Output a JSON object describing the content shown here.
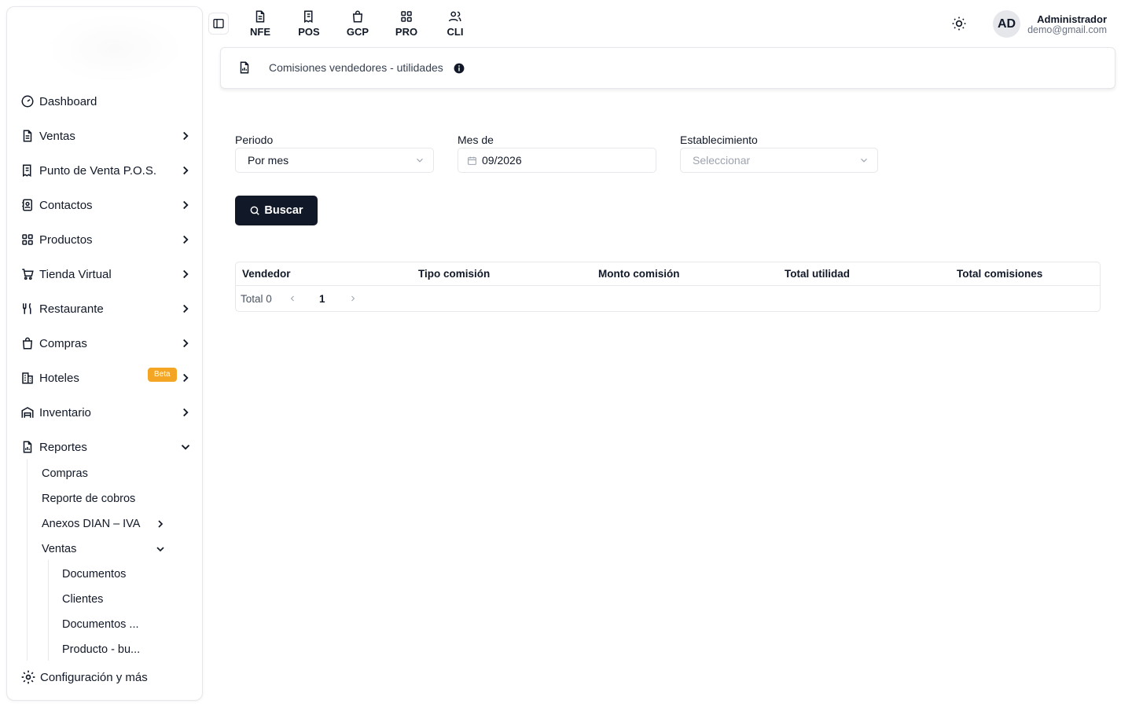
{
  "sidebar": {
    "items": [
      {
        "label": "Dashboard",
        "icon": "gauge-icon"
      },
      {
        "label": "Ventas",
        "icon": "file-text-icon"
      },
      {
        "label": "Punto de Venta P.O.S.",
        "icon": "receipt-icon"
      },
      {
        "label": "Contactos",
        "icon": "contacts-icon"
      },
      {
        "label": "Productos",
        "icon": "grid-icon"
      },
      {
        "label": "Tienda Virtual",
        "icon": "cart-icon"
      },
      {
        "label": "Restaurante",
        "icon": "utensils-icon"
      },
      {
        "label": "Compras",
        "icon": "shopping-bag-icon"
      },
      {
        "label": "Hoteles",
        "icon": "building-icon",
        "badge": "Beta"
      },
      {
        "label": "Inventario",
        "icon": "warehouse-icon"
      },
      {
        "label": "Reportes",
        "icon": "report-icon",
        "expanded": true
      }
    ],
    "reportes_sub": {
      "compras": "Compras",
      "reporte_cobros": "Reporte de cobros",
      "anexos": "Anexos DIAN – IVA",
      "ventas": "Ventas",
      "ventas_sub": [
        "Documentos",
        "Clientes",
        "Documentos ...",
        "Producto - bu..."
      ]
    },
    "config": "Configuración y más"
  },
  "topbar": {
    "modules": [
      "NFE",
      "POS",
      "GCP",
      "PRO",
      "CLI"
    ],
    "avatar_initials": "AD",
    "user_name": "Administrador",
    "user_email": "demo@gmail.com"
  },
  "header": {
    "title": "Comisiones vendedores - utilidades"
  },
  "filters": {
    "periodo_label": "Periodo",
    "periodo_value": "Por mes",
    "mes_label": "Mes de",
    "mes_value": "09/2026",
    "establecimiento_label": "Establecimiento",
    "establecimiento_placeholder": "Seleccionar",
    "search_label": "Buscar"
  },
  "table": {
    "columns": [
      "Vendedor",
      "Tipo comisión",
      "Monto comisión",
      "Total utilidad",
      "Total comisiones"
    ],
    "rows": [],
    "total_text": "Total 0",
    "current_page": "1"
  },
  "colors": {
    "primary": "#111827",
    "badge": "#f5a524",
    "border": "#e5e7eb"
  }
}
